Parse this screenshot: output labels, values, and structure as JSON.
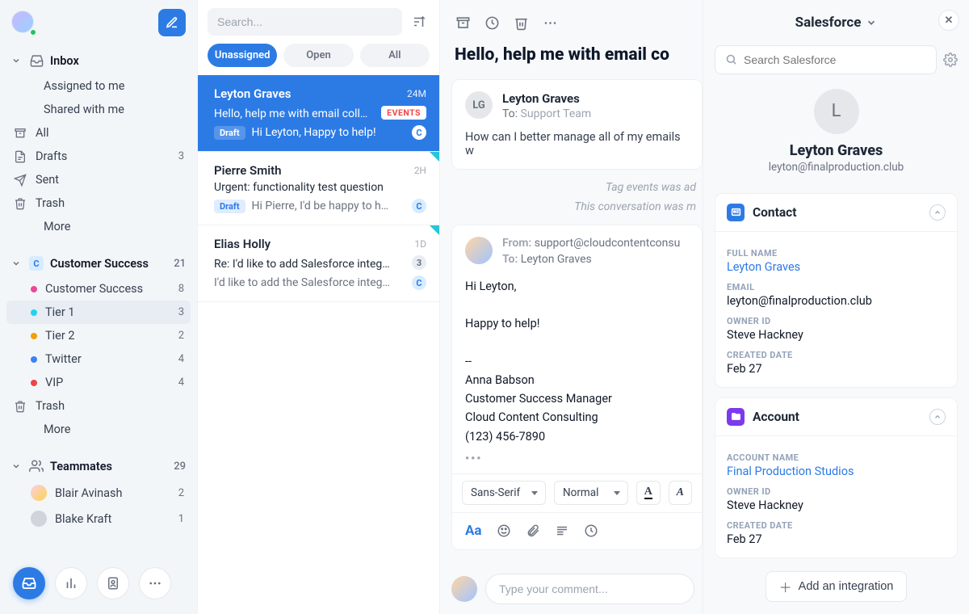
{
  "header": {
    "compose_tooltip": "Compose"
  },
  "sidebar": {
    "inbox": {
      "label": "Inbox",
      "assigned": "Assigned to me",
      "shared": "Shared with me",
      "all": "All",
      "drafts": "Drafts",
      "drafts_count": "3",
      "sent": "Sent",
      "trash": "Trash",
      "more": "More"
    },
    "cs": {
      "label": "Customer Success",
      "count": "21",
      "items": [
        {
          "label": "Customer Success",
          "count": "8",
          "color": "#ec4899"
        },
        {
          "label": "Tier 1",
          "count": "3",
          "color": "#22d3ee"
        },
        {
          "label": "Tier 2",
          "count": "2",
          "color": "#f59e0b"
        },
        {
          "label": "Twitter",
          "count": "4",
          "color": "#3b82f6"
        },
        {
          "label": "VIP",
          "count": "4",
          "color": "#ef4444"
        }
      ],
      "trash": "Trash",
      "more": "More"
    },
    "teammates": {
      "label": "Teammates",
      "count": "29",
      "items": [
        {
          "label": "Blair Avinash",
          "count": "2"
        },
        {
          "label": "Blake Kraft",
          "count": "1"
        }
      ]
    }
  },
  "list": {
    "search_placeholder": "Search...",
    "tabs": {
      "unassigned": "Unassigned",
      "open": "Open",
      "all": "All"
    },
    "items": [
      {
        "name": "Leyton Graves",
        "time": "24M",
        "subject": "Hello, help me with email coll…",
        "tag": "EVENTS",
        "draft": true,
        "preview": "Hi Leyton, Happy to help!",
        "badge": "c",
        "selected": true,
        "stripe": false
      },
      {
        "name": "Pierre Smith",
        "time": "2H",
        "subject": "Urgent: functionality test question",
        "draft": true,
        "preview": "Hi Pierre, I'd be happy to h…",
        "badge": "c",
        "selected": false,
        "stripe": true
      },
      {
        "name": "Elias Holly",
        "time": "1D",
        "subject": "Re: I'd like to add Salesforce integ…",
        "count": "3",
        "preview": "I'd like to add the Salesforce integ…",
        "badge": "c",
        "selected": false,
        "stripe": true
      }
    ]
  },
  "thread": {
    "subject": "Hello, help me with email co",
    "msg": {
      "initials": "LG",
      "from_name": "Leyton Graves",
      "to_label": "To:",
      "to_value": "Support Team",
      "body": "How can I better manage all of my emails w"
    },
    "sys1": "Tag events was ad",
    "sys2": "This conversation was m",
    "compose": {
      "from_label": "From:",
      "from_value": "support@cloudcontentconsu",
      "to_label": "To:",
      "to_value": "Leyton Graves",
      "body": "Hi Leyton,\n\nHappy to help!\n\n--\nAnna Babson\nCustomer Success Manager\nCloud Content Consulting\n(123) 456-7890",
      "font_family": "Sans-Serif",
      "font_size": "Normal",
      "aa": "Aa"
    },
    "comment_placeholder": "Type your comment..."
  },
  "panel": {
    "title": "Salesforce",
    "search_placeholder": "Search Salesforce",
    "contact": {
      "initial": "L",
      "name": "Leyton Graves",
      "email": "leyton@finalproduction.club"
    },
    "contact_card": {
      "title": "Contact",
      "full_name_lbl": "FULL NAME",
      "full_name": "Leyton Graves",
      "email_lbl": "EMAIL",
      "email": "leyton@finalproduction.club",
      "owner_lbl": "OWNER ID",
      "owner": "Steve Hackney",
      "created_lbl": "CREATED DATE",
      "created": "Feb 27"
    },
    "account_card": {
      "title": "Account",
      "name_lbl": "ACCOUNT NAME",
      "name": "Final Production Studios",
      "owner_lbl": "OWNER ID",
      "owner": "Steve Hackney",
      "created_lbl": "CREATED DATE",
      "created": "Feb 27"
    },
    "add_integration": "Add an integration"
  }
}
